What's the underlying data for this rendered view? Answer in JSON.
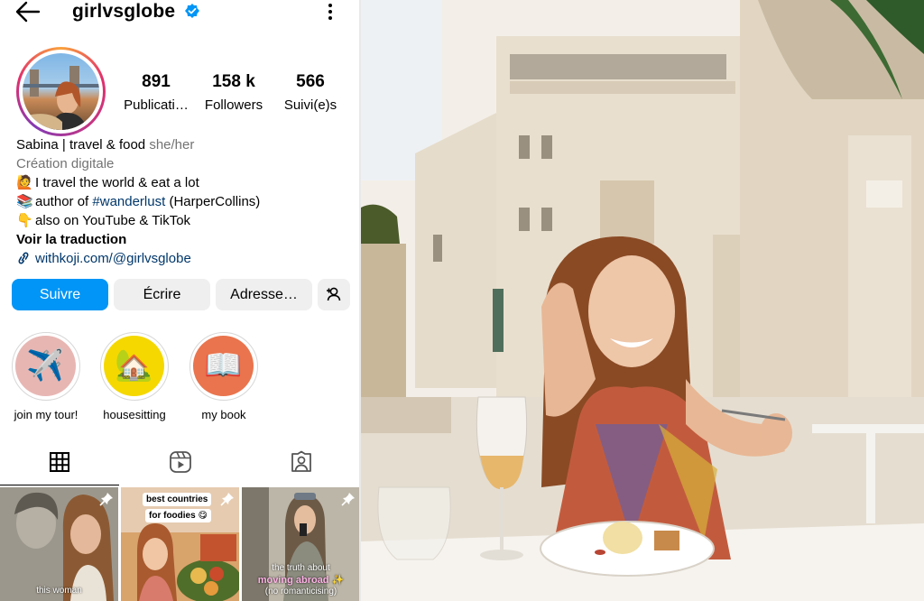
{
  "header": {
    "username": "girlvsglobe"
  },
  "stats": [
    {
      "value": "891",
      "label": "Publicati…"
    },
    {
      "value": "158 k",
      "label": "Followers"
    },
    {
      "value": "566",
      "label": "Suivi(e)s"
    }
  ],
  "bio": {
    "name": "Sabina | travel & food",
    "pronouns": "she/her",
    "category": "Création digitale",
    "line1": "I travel the world & eat a lot",
    "line2_prefix": "author of ",
    "line2_tag": "#wanderlust",
    "line2_suffix": " (HarperCollins)",
    "line3": "also on YouTube & TikTok",
    "translate": "Voir la traduction",
    "link": "withkoji.com/@girlvsglobe"
  },
  "actions": {
    "follow": "Suivre",
    "message": "Écrire",
    "address": "Adresse…"
  },
  "highlights": [
    {
      "label": "join my tour!",
      "icon": "✈️"
    },
    {
      "label": "housesitting",
      "icon": "🏡"
    },
    {
      "label": "my book",
      "icon": "📖"
    }
  ],
  "posts": [
    {
      "caption": "this woman"
    },
    {
      "label_top": "best countries",
      "label_bottom": "for foodies 😋"
    },
    {
      "caption_line1": "the truth about",
      "caption_line2": "moving abroad ✨",
      "caption_line3": "(no romanticising)"
    }
  ],
  "colors": {
    "follow_button": "#0095f6",
    "link": "#00376b",
    "verified": "#0095f6"
  }
}
